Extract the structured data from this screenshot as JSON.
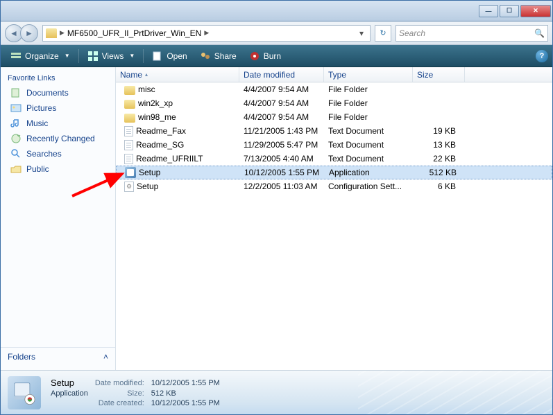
{
  "breadcrumb": {
    "current": "MF6500_UFR_II_PrtDriver_Win_EN"
  },
  "search": {
    "placeholder": "Search"
  },
  "toolbar": {
    "organize": "Organize",
    "views": "Views",
    "open": "Open",
    "share": "Share",
    "burn": "Burn"
  },
  "sidebar": {
    "header": "Favorite Links",
    "items": [
      {
        "label": "Documents",
        "icon": "documents"
      },
      {
        "label": "Pictures",
        "icon": "pictures"
      },
      {
        "label": "Music",
        "icon": "music"
      },
      {
        "label": "Recently Changed",
        "icon": "recent"
      },
      {
        "label": "Searches",
        "icon": "searches"
      },
      {
        "label": "Public",
        "icon": "public"
      }
    ],
    "folders": "Folders"
  },
  "columns": {
    "name": "Name",
    "date": "Date modified",
    "type": "Type",
    "size": "Size"
  },
  "files": [
    {
      "name": "misc",
      "date": "4/4/2007 9:54 AM",
      "type": "File Folder",
      "size": "",
      "icon": "folder"
    },
    {
      "name": "win2k_xp",
      "date": "4/4/2007 9:54 AM",
      "type": "File Folder",
      "size": "",
      "icon": "folder"
    },
    {
      "name": "win98_me",
      "date": "4/4/2007 9:54 AM",
      "type": "File Folder",
      "size": "",
      "icon": "folder"
    },
    {
      "name": "Readme_Fax",
      "date": "11/21/2005 1:43 PM",
      "type": "Text Document",
      "size": "19 KB",
      "icon": "txt"
    },
    {
      "name": "Readme_SG",
      "date": "11/29/2005 5:47 PM",
      "type": "Text Document",
      "size": "13 KB",
      "icon": "txt"
    },
    {
      "name": "Readme_UFRIILT",
      "date": "7/13/2005 4:40 AM",
      "type": "Text Document",
      "size": "22 KB",
      "icon": "txt"
    },
    {
      "name": "Setup",
      "date": "10/12/2005 1:55 PM",
      "type": "Application",
      "size": "512 KB",
      "icon": "exe",
      "selected": true
    },
    {
      "name": "Setup",
      "date": "12/2/2005 11:03 AM",
      "type": "Configuration Sett...",
      "size": "6 KB",
      "icon": "cfg"
    }
  ],
  "details": {
    "name": "Setup",
    "type": "Application",
    "labels": {
      "modified": "Date modified:",
      "size": "Size:",
      "created": "Date created:"
    },
    "modified": "10/12/2005 1:55 PM",
    "size": "512 KB",
    "created": "10/12/2005 1:55 PM"
  }
}
